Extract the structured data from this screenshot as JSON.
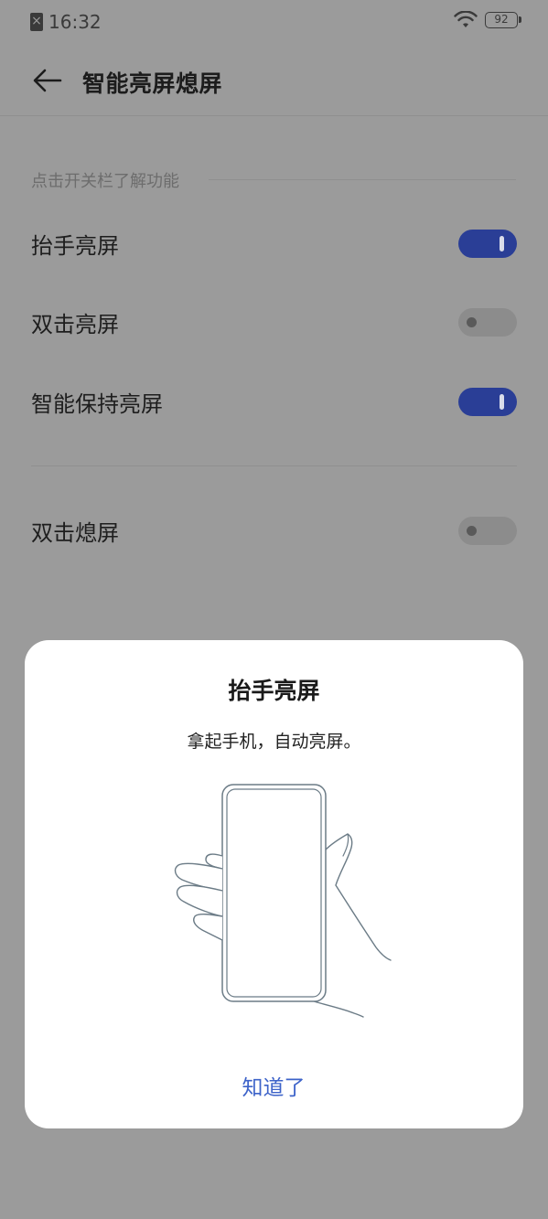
{
  "status_bar": {
    "time": "16:32",
    "battery": "92",
    "icons": [
      "sim-off-icon",
      "wifi-icon",
      "battery-icon"
    ]
  },
  "header": {
    "title": "智能亮屏熄屏",
    "back_icon": "back-arrow-icon"
  },
  "section_hint": "点击开关栏了解功能",
  "settings": [
    {
      "label": "抬手亮屏",
      "enabled": true
    },
    {
      "label": "双击亮屏",
      "enabled": false
    },
    {
      "label": "智能保持亮屏",
      "enabled": true
    },
    {
      "label": "双击熄屏",
      "enabled": false
    }
  ],
  "dialog": {
    "title": "抬手亮屏",
    "description": "拿起手机，自动亮屏。",
    "illustration": "hand-holding-phone-illustration",
    "button_label": "知道了"
  },
  "colors": {
    "toggle_on": "#2a3e96",
    "toggle_off": "#8c8c8c",
    "accent_button": "#3d63c9",
    "scrim": "#9b9b9b"
  }
}
